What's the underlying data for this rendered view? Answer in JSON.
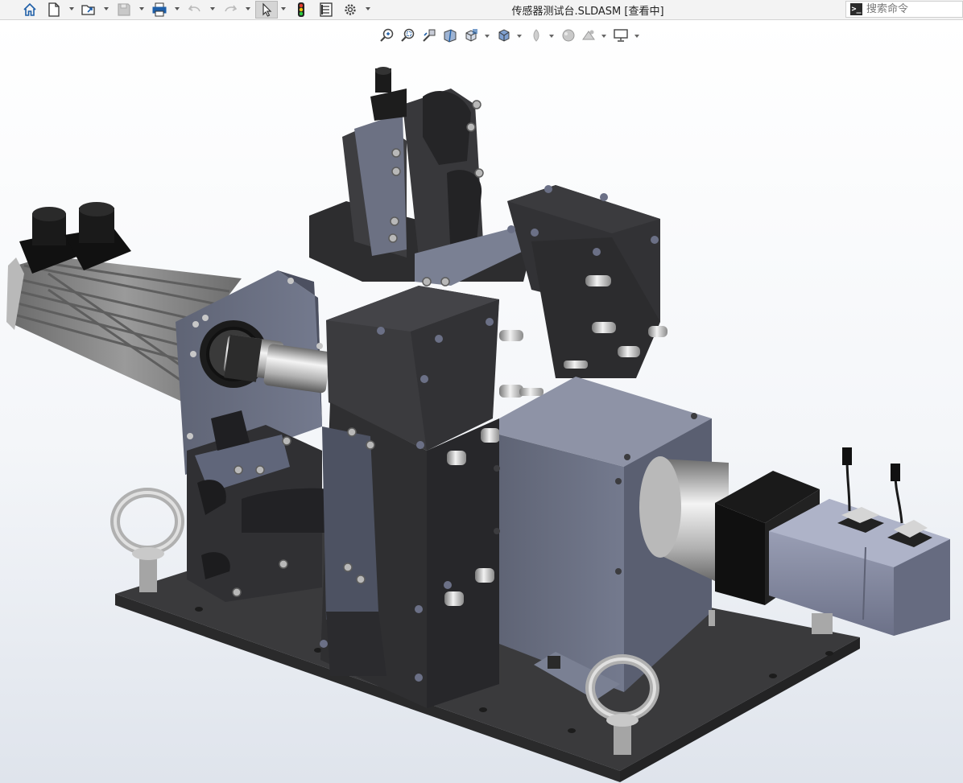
{
  "window": {
    "title": "传感器测试台.SLDASM [查看中]"
  },
  "toolbar": {
    "buttons": [
      {
        "name": "home-icon"
      },
      {
        "name": "new-document-icon"
      },
      {
        "name": "open-folder-icon"
      },
      {
        "name": "save-icon"
      },
      {
        "name": "print-icon"
      },
      {
        "name": "undo-icon"
      },
      {
        "name": "redo-icon"
      },
      {
        "name": "select-arrow-icon"
      },
      {
        "name": "traffic-light-icon"
      },
      {
        "name": "file-properties-icon"
      },
      {
        "name": "options-gear-icon"
      }
    ]
  },
  "search": {
    "placeholder": "搜索命令"
  },
  "view_toolbar": {
    "buttons": [
      {
        "name": "zoom-to-fit-icon"
      },
      {
        "name": "zoom-to-area-icon"
      },
      {
        "name": "previous-view-icon"
      },
      {
        "name": "section-view-icon"
      },
      {
        "name": "view-orientation-icon"
      },
      {
        "name": "display-style-icon"
      },
      {
        "name": "hide-show-items-icon"
      },
      {
        "name": "edit-appearance-icon"
      },
      {
        "name": "apply-scene-icon"
      },
      {
        "name": "view-settings-icon"
      }
    ]
  },
  "colors": {
    "toolbar_bg": "#f3f3f3",
    "accent_blue": "#1f5fa8",
    "part_dark": "#3b3b3e",
    "part_blue_gray": "#6f7487",
    "motor_light": "#8a90a6"
  }
}
